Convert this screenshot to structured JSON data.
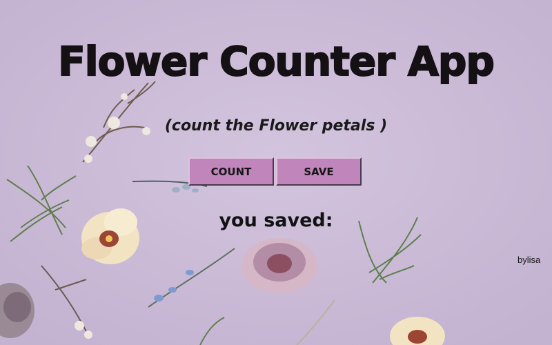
{
  "app": {
    "title": "Flower Counter App",
    "subtitle": "(count the Flower petals )",
    "saved_label": "you saved:",
    "credit": "bylisa"
  },
  "buttons": {
    "count_label": "COUNT",
    "save_label": "SAVE"
  },
  "colors": {
    "background": "#cbbbd7",
    "button": "#c085bb",
    "text": "#141014"
  }
}
